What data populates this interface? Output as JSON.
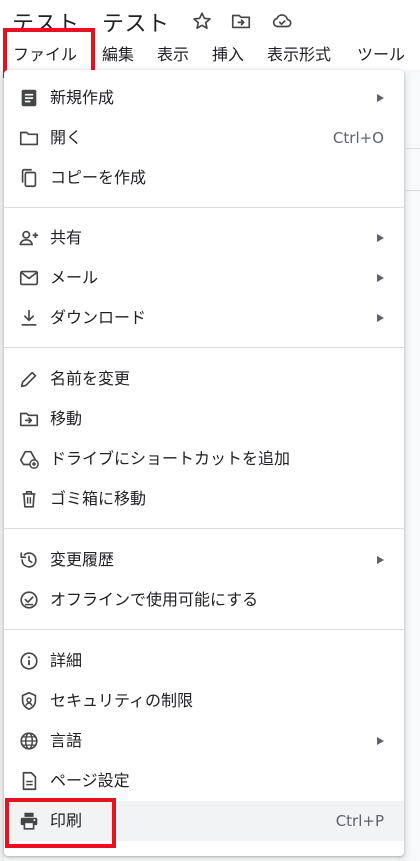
{
  "document": {
    "title": "テスト　テスト",
    "icons": [
      "star-icon",
      "move-to-folder-icon",
      "cloud-saved-icon"
    ]
  },
  "menubar": {
    "items": [
      "ファイル",
      "編集",
      "表示",
      "挿入",
      "表示形式",
      "ツール"
    ]
  },
  "file_menu": {
    "items": [
      {
        "label": "新規作成",
        "icon": "document-icon",
        "submenu": true
      },
      {
        "label": "開く",
        "icon": "folder-open-icon",
        "shortcut": "Ctrl+O"
      },
      {
        "label": "コピーを作成",
        "icon": "copy-icon"
      },
      {
        "label": "共有",
        "icon": "person-add-icon",
        "submenu": true
      },
      {
        "label": "メール",
        "icon": "email-icon",
        "submenu": true
      },
      {
        "label": "ダウンロード",
        "icon": "download-icon",
        "submenu": true
      },
      {
        "label": "名前を変更",
        "icon": "pencil-icon"
      },
      {
        "label": "移動",
        "icon": "move-folder-icon"
      },
      {
        "label": "ドライブにショートカットを追加",
        "icon": "drive-shortcut-icon"
      },
      {
        "label": "ゴミ箱に移動",
        "icon": "trash-icon"
      },
      {
        "label": "変更履歴",
        "icon": "history-icon",
        "submenu": true
      },
      {
        "label": "オフラインで使用可能にする",
        "icon": "offline-icon"
      },
      {
        "label": "詳細",
        "icon": "info-icon"
      },
      {
        "label": "セキュリティの制限",
        "icon": "security-icon"
      },
      {
        "label": "言語",
        "icon": "globe-icon",
        "submenu": true
      },
      {
        "label": "ページ設定",
        "icon": "page-setup-icon"
      },
      {
        "label": "印刷",
        "icon": "printer-icon",
        "shortcut": "Ctrl+P",
        "highlighted": true
      }
    ]
  },
  "colors": {
    "highlight_border": "#e8111e",
    "icon": "#444746",
    "text": "#202124",
    "shortcut": "#5f6368",
    "hover": "#f1f3f4"
  }
}
